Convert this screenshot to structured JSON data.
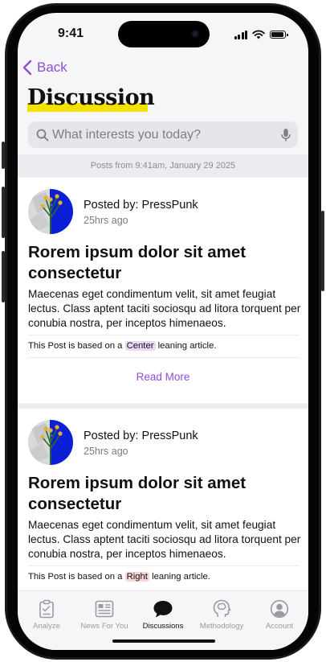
{
  "status": {
    "time": "9:41"
  },
  "nav": {
    "back_label": "Back"
  },
  "page": {
    "title": "Discussion"
  },
  "search": {
    "placeholder": "What interests you today?"
  },
  "banner": {
    "text": "Posts from 9:41am, January 29 2025"
  },
  "posts": [
    {
      "poster": "Posted by: PressPunk",
      "age": "25hrs ago",
      "title": "Rorem ipsum dolor sit amet consectetur",
      "body": "Maecenas eget condimentum velit, sit amet feugiat lectus. Class aptent taciti sociosqu ad litora torquent per conubia nostra, per inceptos himenaeos.",
      "lean_prefix": "This Post is based on a",
      "lean": "Center",
      "lean_suffix": "leaning article.",
      "lean_color": "#ecd7f7",
      "read_more": "Read More"
    },
    {
      "poster": "Posted by: PressPunk",
      "age": "25hrs ago",
      "title": "Rorem ipsum dolor sit amet consectetur",
      "body": "Maecenas eget condimentum velit, sit amet feugiat lectus. Class aptent taciti sociosqu ad litora torquent per conubia nostra, per inceptos himenaeos.",
      "lean_prefix": "This Post is based on a",
      "lean": "Right",
      "lean_suffix": "leaning article.",
      "lean_color": "#f8d7d7"
    }
  ],
  "tabs": [
    {
      "label": "Analyze",
      "icon": "clipboard-icon"
    },
    {
      "label": "News For You",
      "icon": "newspaper-icon"
    },
    {
      "label": "Discussions",
      "icon": "chat-bubble-icon",
      "active": true
    },
    {
      "label": "Methodology",
      "icon": "brain-head-icon"
    },
    {
      "label": "Account",
      "icon": "person-circle-icon"
    }
  ],
  "colors": {
    "accent": "#8f4dd6",
    "title_highlight": "#f3e200",
    "avatar_blue": "#0d1fd6"
  }
}
